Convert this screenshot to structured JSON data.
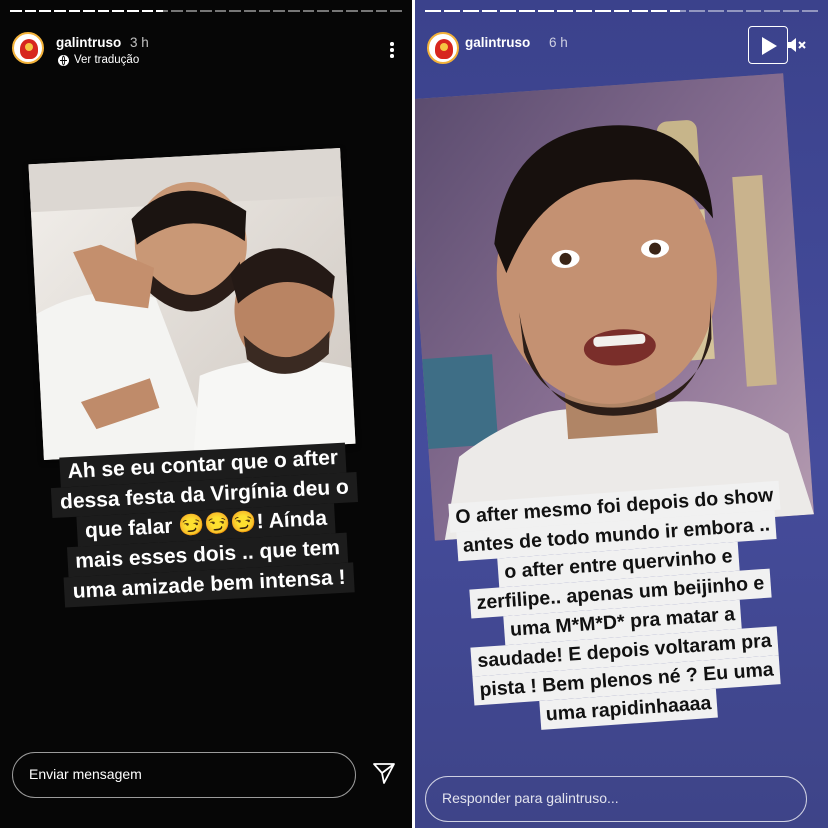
{
  "left_story": {
    "progress": [
      1,
      1,
      1,
      1,
      1,
      1,
      1,
      1,
      1,
      1,
      0.6,
      0,
      0,
      0,
      0,
      0,
      0,
      0,
      0,
      0,
      0,
      0,
      0,
      0,
      0,
      0,
      0
    ],
    "username": "galintruso",
    "time": "3 h",
    "translate_label": "Ver tradução",
    "menu_icon": "more-vertical-icon",
    "caption_lines": [
      "Ah se eu contar que o after",
      "dessa festa da Virgínia deu o",
      "que falar 😏😏😏! Aínda",
      "mais esses dois .. que tem",
      "uma amizade bem intensa !"
    ],
    "reply_placeholder": "Enviar mensagem",
    "send_icon": "paper-plane-icon"
  },
  "right_story": {
    "progress": [
      1,
      1,
      1,
      1,
      1,
      1,
      1,
      1,
      1,
      1,
      1,
      1,
      1,
      0.6,
      0,
      0,
      0,
      0,
      0,
      0,
      0
    ],
    "username": "galintruso",
    "time": "6 h",
    "play_icon": "play-icon",
    "mute_icon": "volume-muted-icon",
    "caption_lines": [
      "O after mesmo foi depois do show",
      "antes de todo mundo ir embora ..",
      "o after entre quervinho e",
      "zerfilipe.. apenas um beijinho e",
      "uma M*M*D* pra matar a",
      "saudade!  E depois voltaram pra",
      "pista ! Bem plenos né ? Eu uma",
      "uma rapidinhaaaa"
    ],
    "reply_placeholder": "Responder para galintruso..."
  },
  "colors": {
    "left_bg": "#060606",
    "right_bg": "#3f4694",
    "left_caption_bg": "#1c1c1c",
    "right_caption_bg": "#f1f1f1",
    "avatar_ring": "#f3b23a"
  }
}
